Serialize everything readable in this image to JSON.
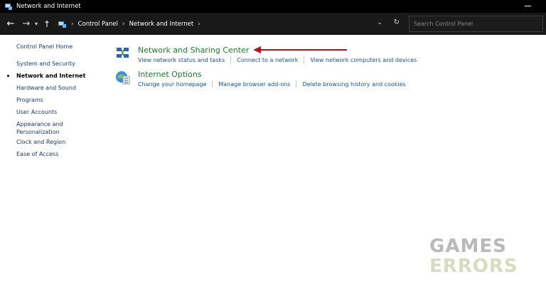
{
  "window": {
    "title": "Network and Internet"
  },
  "address_bar": {
    "breadcrumbs": [
      "Control Panel",
      "Network and Internet"
    ],
    "search_placeholder": "Search Control Panel"
  },
  "left_pane": {
    "items": [
      {
        "label": "Control Panel Home",
        "active": false
      },
      {
        "label": "System and Security",
        "active": false
      },
      {
        "label": "Network and Internet",
        "active": true
      },
      {
        "label": "Hardware and Sound",
        "active": false
      },
      {
        "label": "Programs",
        "active": false
      },
      {
        "label": "User Accounts",
        "active": false
      },
      {
        "label": "Appearance and Personalization",
        "active": false
      },
      {
        "label": "Clock and Region",
        "active": false
      },
      {
        "label": "Ease of Access",
        "active": false
      }
    ]
  },
  "main": {
    "categories": [
      {
        "title": "Network and Sharing Center",
        "links": [
          "View network status and tasks",
          "Connect to a network",
          "View network computers and devices"
        ]
      },
      {
        "title": "Internet Options",
        "links": [
          "Change your homepage",
          "Manage browser add-ons",
          "Delete browsing history and cookies"
        ]
      }
    ]
  },
  "watermark": {
    "line1": "GAMES",
    "line2": "ERRORS"
  },
  "colors": {
    "category_title": "#217a2c",
    "link": "#1a4f9c",
    "arrow": "#b0131a",
    "titlebar": "#000000"
  }
}
